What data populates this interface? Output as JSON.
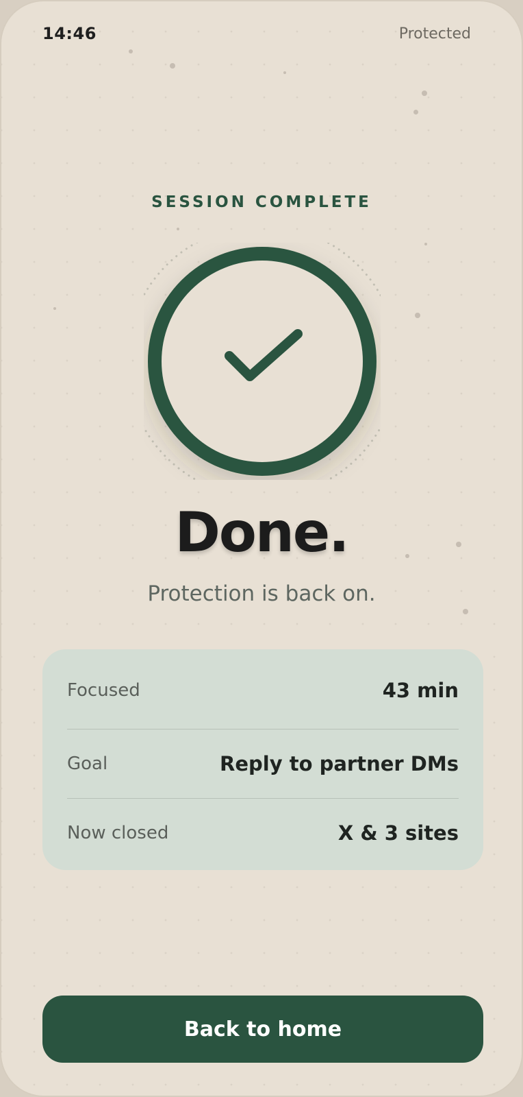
{
  "status_bar": {
    "time": "14:46",
    "status": "Protected"
  },
  "eyebrow": "SESSION COMPLETE",
  "hero": {
    "icon": "checkmark-circle-icon",
    "title": "Done.",
    "subtitle": "Protection is back on."
  },
  "summary": {
    "rows": [
      {
        "label": "Focused",
        "value": "43 min"
      },
      {
        "label": "Goal",
        "value": "Reply to partner DMs"
      },
      {
        "label": "Now closed",
        "value": "X & 3 sites"
      }
    ]
  },
  "cta": {
    "label": "Back to home"
  },
  "colors": {
    "background": "#e8e0d4",
    "accent": "#2a5440",
    "card": "#d3ddd4"
  }
}
